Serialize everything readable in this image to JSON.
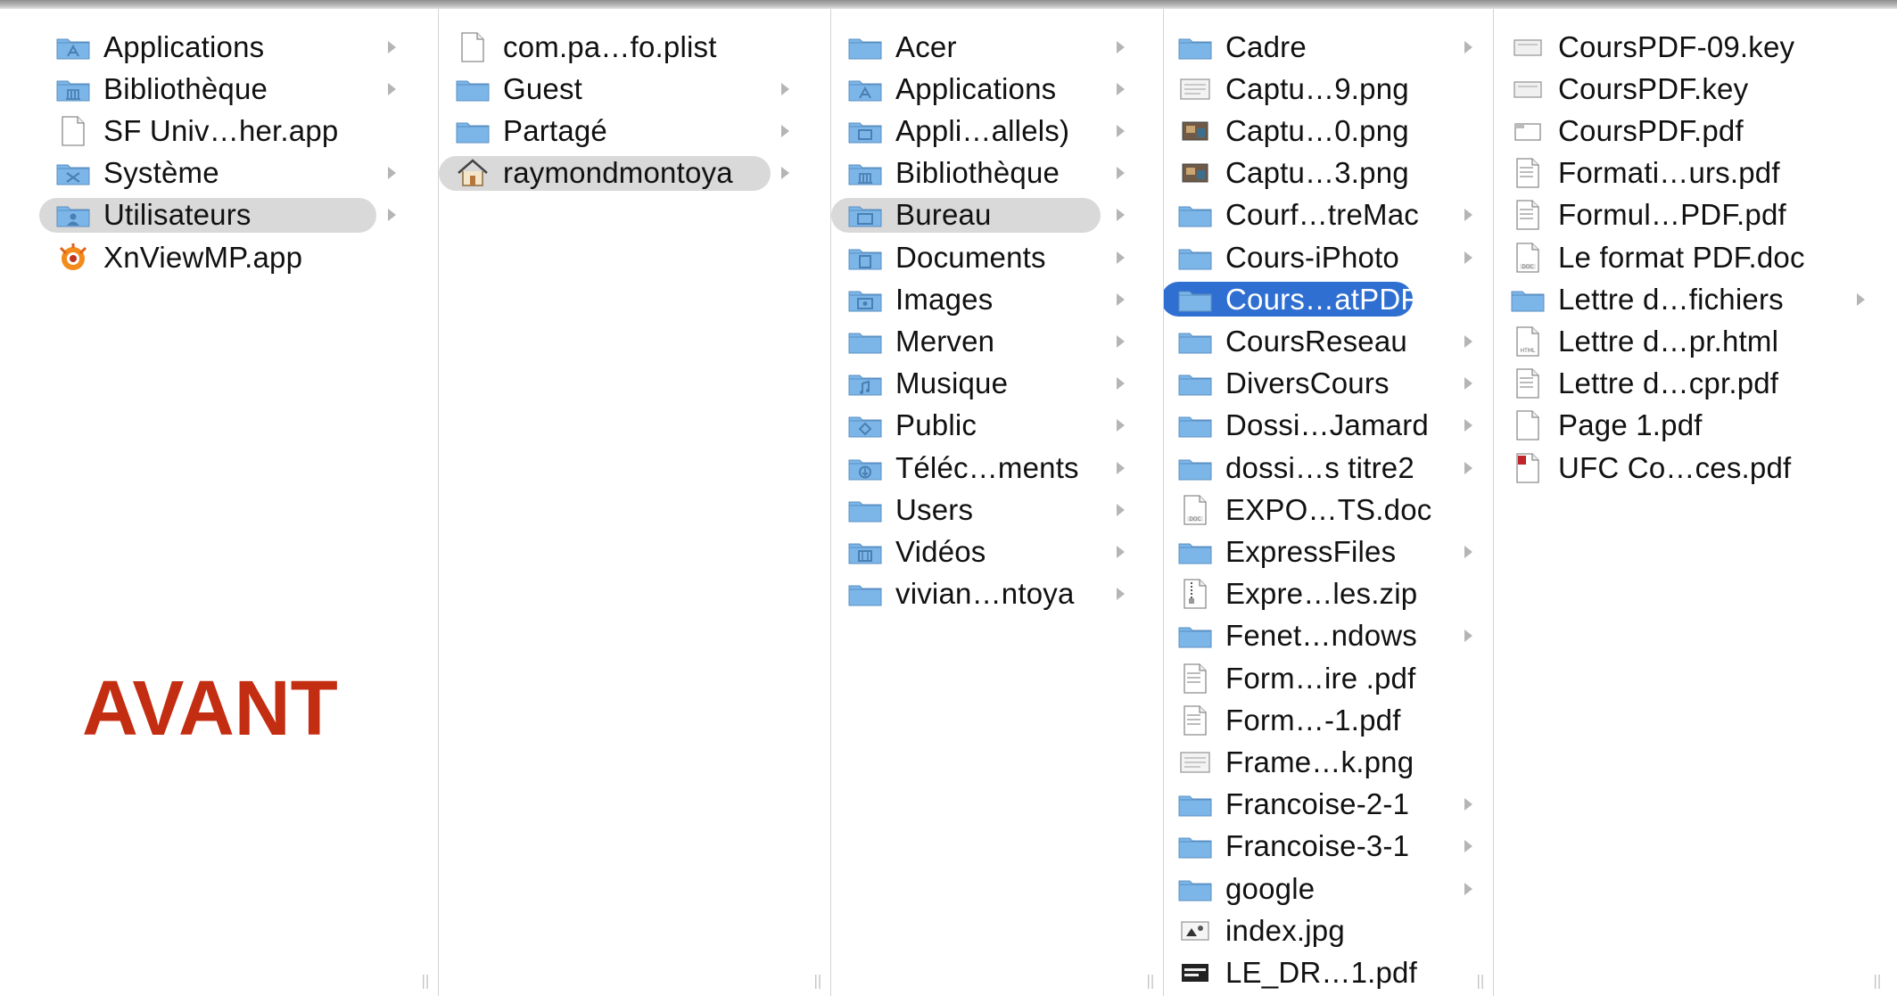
{
  "caption": "AVANT",
  "colors": {
    "folder": "#7cb6e8",
    "selection": "#2f6fd1",
    "path_highlight": "#d9d9d9",
    "caption": "#c32d12",
    "arrow": "#b5b5b5"
  },
  "columns": [
    {
      "name": "root",
      "items": [
        {
          "label": "Applications",
          "icon": "applications-folder-icon",
          "arrow": true
        },
        {
          "label": "Bibliothèque",
          "icon": "library-folder-icon",
          "arrow": true
        },
        {
          "label": "SF Univ…her.app",
          "icon": "document-icon",
          "arrow": false
        },
        {
          "label": "Système",
          "icon": "system-folder-icon",
          "arrow": true
        },
        {
          "label": "Utilisateurs",
          "icon": "users-folder-icon",
          "arrow": true,
          "state": "path"
        },
        {
          "label": "XnViewMP.app",
          "icon": "xnview-app-icon",
          "arrow": false
        }
      ]
    },
    {
      "name": "utilisateurs",
      "items": [
        {
          "label": "com.pa…fo.plist",
          "icon": "document-icon",
          "arrow": false
        },
        {
          "label": "Guest",
          "icon": "folder-icon",
          "arrow": true
        },
        {
          "label": "Partagé",
          "icon": "folder-icon",
          "arrow": true
        },
        {
          "label": "raymondmontoya",
          "icon": "home-icon",
          "arrow": true,
          "state": "path"
        }
      ]
    },
    {
      "name": "home",
      "items": [
        {
          "label": "Acer",
          "icon": "folder-icon",
          "arrow": true
        },
        {
          "label": "Applications",
          "icon": "applications-folder-icon",
          "arrow": true
        },
        {
          "label": "Appli…allels)",
          "icon": "parallels-folder-icon",
          "arrow": true
        },
        {
          "label": "Bibliothèque",
          "icon": "library-folder-icon",
          "arrow": true
        },
        {
          "label": "Bureau",
          "icon": "desktop-folder-icon",
          "arrow": true,
          "state": "path"
        },
        {
          "label": "Documents",
          "icon": "documents-folder-icon",
          "arrow": true
        },
        {
          "label": "Images",
          "icon": "pictures-folder-icon",
          "arrow": true
        },
        {
          "label": "Merven",
          "icon": "folder-icon",
          "arrow": true
        },
        {
          "label": "Musique",
          "icon": "music-folder-icon",
          "arrow": true
        },
        {
          "label": "Public",
          "icon": "public-folder-icon",
          "arrow": true
        },
        {
          "label": "Téléc…ments",
          "icon": "downloads-folder-icon",
          "arrow": true
        },
        {
          "label": "Users",
          "icon": "folder-icon",
          "arrow": true
        },
        {
          "label": "Vidéos",
          "icon": "movies-folder-icon",
          "arrow": true
        },
        {
          "label": "vivian…ntoya",
          "icon": "folder-icon",
          "arrow": true
        }
      ]
    },
    {
      "name": "bureau",
      "items": [
        {
          "label": "Cadre",
          "icon": "folder-icon",
          "arrow": true
        },
        {
          "label": "Captu…9.png",
          "icon": "png-file-icon",
          "arrow": false
        },
        {
          "label": "Captu…0.png",
          "icon": "image-thumbnail-icon",
          "arrow": false
        },
        {
          "label": "Captu…3.png",
          "icon": "image-thumbnail-icon",
          "arrow": false
        },
        {
          "label": "Courf…treMac",
          "icon": "folder-icon",
          "arrow": true
        },
        {
          "label": "Cours-iPhoto",
          "icon": "folder-icon",
          "arrow": true
        },
        {
          "label": "Cours…atPDF",
          "icon": "folder-icon",
          "arrow": true,
          "state": "selected"
        },
        {
          "label": "CoursReseau",
          "icon": "folder-icon",
          "arrow": true
        },
        {
          "label": "DiversCours",
          "icon": "folder-icon",
          "arrow": true
        },
        {
          "label": "Dossi…Jamard",
          "icon": "folder-icon",
          "arrow": true
        },
        {
          "label": "dossi…s titre2",
          "icon": "folder-icon",
          "arrow": true
        },
        {
          "label": "EXPO…TS.doc",
          "icon": "doc-file-icon",
          "arrow": false
        },
        {
          "label": "ExpressFiles",
          "icon": "folder-icon",
          "arrow": true
        },
        {
          "label": "Expre…les.zip",
          "icon": "zip-file-icon",
          "arrow": false
        },
        {
          "label": "Fenet…ndows",
          "icon": "folder-icon",
          "arrow": true
        },
        {
          "label": "Form…ire .pdf",
          "icon": "pdf-file-icon",
          "arrow": false
        },
        {
          "label": "Form…-1.pdf",
          "icon": "pdf-file-icon",
          "arrow": false
        },
        {
          "label": "Frame…k.png",
          "icon": "png-file-icon",
          "arrow": false
        },
        {
          "label": "Francoise-2-1",
          "icon": "folder-icon",
          "arrow": true
        },
        {
          "label": "Francoise-3-1",
          "icon": "folder-icon",
          "arrow": true
        },
        {
          "label": "google",
          "icon": "folder-icon",
          "arrow": true
        },
        {
          "label": "index.jpg",
          "icon": "jpg-file-icon",
          "arrow": false
        },
        {
          "label": "LE_DR…1.pdf",
          "icon": "pdf-dark-file-icon",
          "arrow": false
        }
      ]
    },
    {
      "name": "coursformatpdf",
      "items": [
        {
          "label": "CoursPDF-09.key",
          "icon": "keynote-file-icon",
          "arrow": false
        },
        {
          "label": "CoursPDF.key",
          "icon": "keynote-file-icon",
          "arrow": false
        },
        {
          "label": "CoursPDF.pdf",
          "icon": "pdf-preview-file-icon",
          "arrow": false
        },
        {
          "label": "Formati…urs.pdf",
          "icon": "pdf-file-icon",
          "arrow": false
        },
        {
          "label": "Formul…PDF.pdf",
          "icon": "pdf-file-icon",
          "arrow": false
        },
        {
          "label": "Le format PDF.doc",
          "icon": "doc-file-icon",
          "arrow": false
        },
        {
          "label": "Lettre d…fichiers",
          "icon": "folder-icon",
          "arrow": true
        },
        {
          "label": "Lettre d…pr.html",
          "icon": "html-file-icon",
          "arrow": false
        },
        {
          "label": "Lettre d…cpr.pdf",
          "icon": "pdf-file-icon",
          "arrow": false
        },
        {
          "label": "Page 1.pdf",
          "icon": "blank-pdf-file-icon",
          "arrow": false
        },
        {
          "label": "UFC Co…ces.pdf",
          "icon": "red-pdf-file-icon",
          "arrow": false
        }
      ]
    }
  ]
}
